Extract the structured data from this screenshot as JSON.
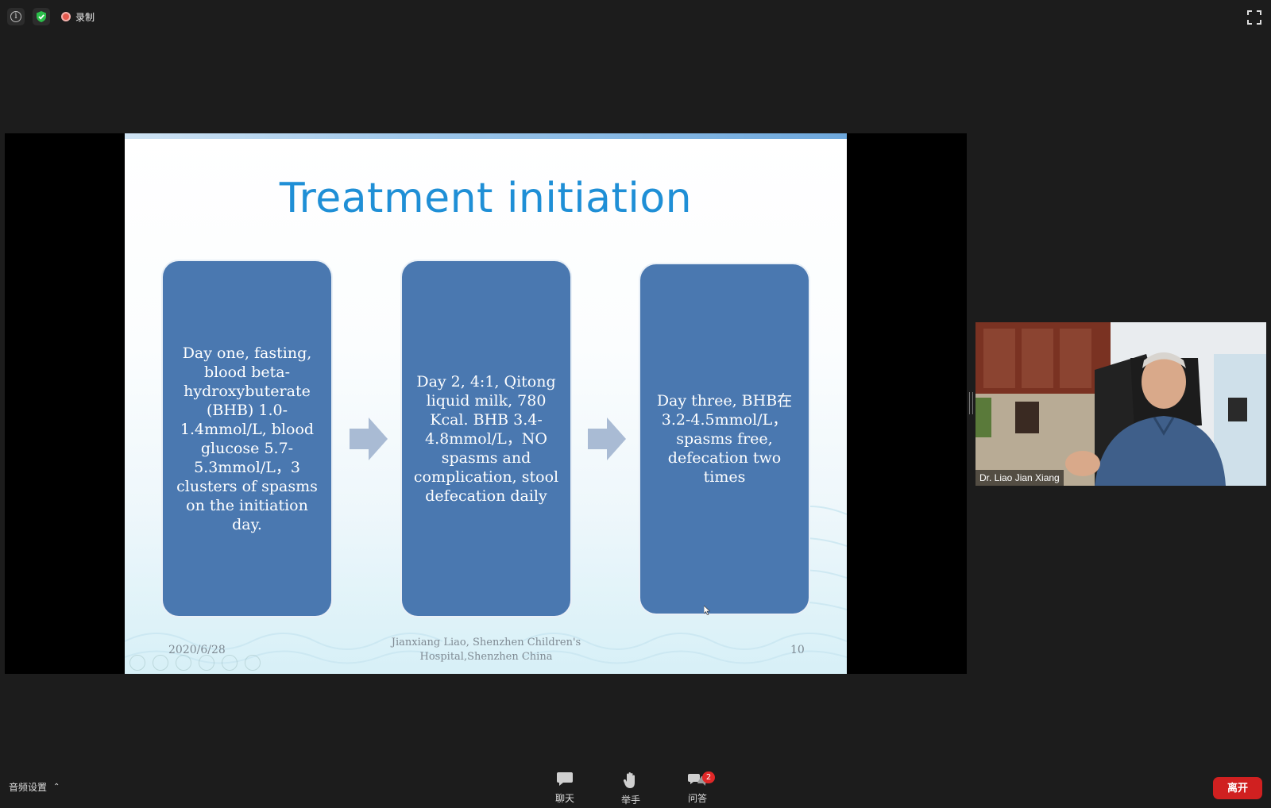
{
  "top_bar": {
    "info_icon": "info-icon",
    "security_icon": "shield-check-icon",
    "record_label": "录制",
    "fullscreen_icon": "fullscreen-icon"
  },
  "slide": {
    "title": "Treatment initiation",
    "boxes": [
      "Day one, fasting, blood beta-hydroxybuterate (BHB) 1.0-1.4mmol/L, blood glucose 5.7-5.3mmol/L，3 clusters of spasms on the initiation day.",
      "Day 2, 4:1, Qitong liquid milk, 780 Kcal. BHB 3.4-4.8mmol/L，NO spasms and complication, stool defecation daily",
      "Day three, BHB在3.2-4.5mmol/L，spasms free, defecation two times"
    ],
    "date": "2020/6/28",
    "footer": "Jianxiang Liao, Shenzhen Children's Hospital,Shenzhen China",
    "page_number": "10",
    "colors": {
      "title": "#1f8fd6",
      "box": "#4a78b0",
      "arrow": "#a9bbd4"
    }
  },
  "video": {
    "participant_name": "Dr. Liao Jian Xiang"
  },
  "bottom_bar": {
    "audio_settings_label": "音频设置",
    "chat_label": "聊天",
    "raise_hand_label": "举手",
    "qa_label": "问答",
    "qa_badge": "2",
    "leave_label": "离开",
    "leave_color": "#d02020"
  }
}
